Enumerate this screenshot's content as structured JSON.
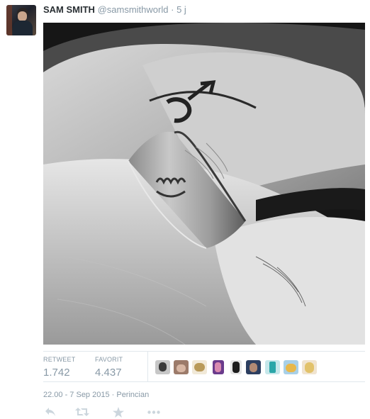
{
  "tweet": {
    "author_name": "SAM SMITH",
    "handle": "@samsmithworld",
    "separator": "·",
    "time": "5 j",
    "stats": {
      "retweet_label": "RETWEET",
      "retweet_count": "1.742",
      "favorite_label": "FAVORIT",
      "favorite_count": "4.437"
    },
    "favoriters": [
      "avatar-1",
      "avatar-2",
      "avatar-3",
      "avatar-4",
      "avatar-5",
      "avatar-6",
      "avatar-7",
      "avatar-8",
      "avatar-9"
    ],
    "timestamp": "22.00 - 7 Sep 2015 · Perincian",
    "actions": [
      "reply-icon",
      "retweet-icon",
      "favorite-star-icon",
      "more-icon"
    ]
  },
  "colors": {
    "text_primary": "#292f33",
    "text_secondary": "#8899a6",
    "divider": "#e1e8ed",
    "action_icon": "#ccd6dd"
  }
}
